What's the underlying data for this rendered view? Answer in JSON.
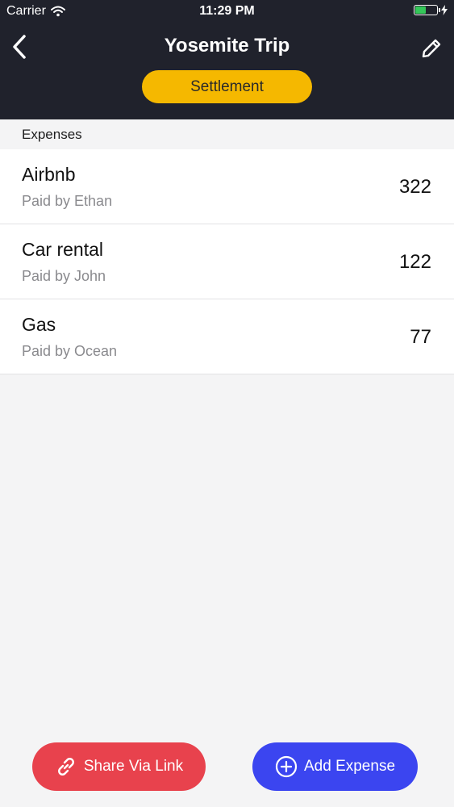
{
  "status_bar": {
    "carrier": "Carrier",
    "time": "11:29 PM",
    "battery_level": 0.45,
    "battery_color": "#34c759"
  },
  "nav": {
    "title": "Yosemite Trip",
    "back_icon": "chevron-left-icon",
    "edit_icon": "pencil-icon",
    "settlement_label": "Settlement",
    "settlement_color": "#f5b800",
    "background": "#20222c"
  },
  "expenses": {
    "section_label": "Expenses",
    "items": [
      {
        "name": "Airbnb",
        "payer": "Paid by Ethan",
        "amount": "322"
      },
      {
        "name": "Car rental",
        "payer": "Paid by John",
        "amount": "122"
      },
      {
        "name": "Gas",
        "payer": "Paid by Ocean",
        "amount": "77"
      }
    ]
  },
  "actions": {
    "share_label": "Share Via Link",
    "share_icon": "link-icon",
    "share_color": "#e8424d",
    "add_label": "Add Expense",
    "add_icon": "plus-circle-icon",
    "add_color": "#3b45f0"
  }
}
